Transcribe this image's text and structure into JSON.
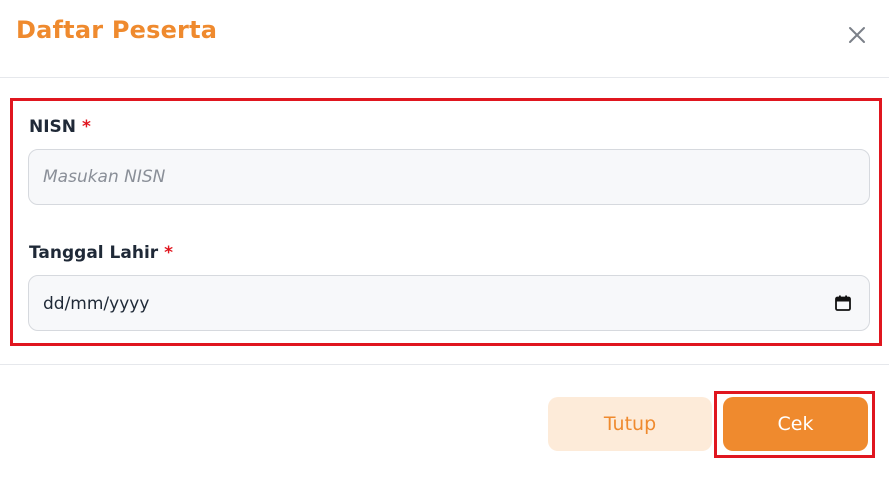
{
  "modal": {
    "title": "Daftar Peserta",
    "close_icon": "close-icon"
  },
  "form": {
    "nisn": {
      "label": "NISN",
      "required_mark": "*",
      "placeholder": "Masukan NISN",
      "value": ""
    },
    "tanggal_lahir": {
      "label": "Tanggal Lahir",
      "required_mark": "*",
      "value": "dd/mm/yyyy",
      "icon": "calendar-icon"
    }
  },
  "footer": {
    "close_label": "Tutup",
    "check_label": "Cek"
  },
  "colors": {
    "accent": "#ef8a2e",
    "accent_light": "#fdebd9",
    "highlight": "#e0161f"
  }
}
